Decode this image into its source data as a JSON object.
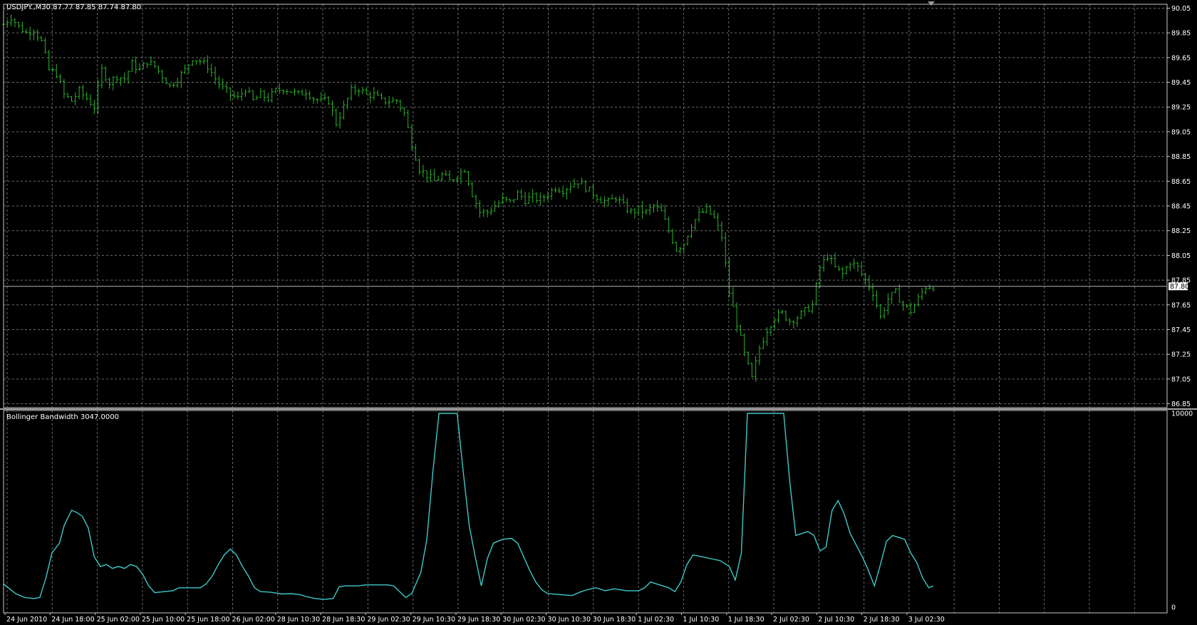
{
  "window": {
    "symbol_header": "USDJPY.,M30  87.77 87.85 87.74 87.80",
    "indicator_header": "Bollinger Bandwidth 3047.0000"
  },
  "colors": {
    "background": "#000000",
    "grid": "#6b6b6b",
    "bars": "#2db32d",
    "indicator": "#3fc8c8",
    "frame": "#c8c8c8",
    "price_line": "#b4b4b4"
  },
  "chart_data": [
    {
      "type": "bar",
      "title": "USDJPY.,M30",
      "ohlc_header": "87.77 87.85 87.74 87.80",
      "y_ticks": [
        "90.05",
        "89.85",
        "89.65",
        "89.45",
        "89.25",
        "89.05",
        "88.85",
        "88.65",
        "88.45",
        "88.25",
        "88.05",
        "87.85",
        "87.65",
        "87.45",
        "87.25",
        "87.05",
        "86.85"
      ],
      "ylim": [
        86.83,
        90.07
      ],
      "current_price": "87.80",
      "x_ticks": [
        "24 Jun 2010",
        "24 Jun 18:00",
        "25 Jun 02:00",
        "25 Jun 10:00",
        "25 Jun 18:00",
        "26 Jun 02:00",
        "28 Jun 10:30",
        "28 Jun 18:30",
        "29 Jun 02:30",
        "29 Jun 10:30",
        "29 Jun 18:30",
        "30 Jun 02:30",
        "30 Jun 10:30",
        "30 Jun 18:30",
        "1 Jul 02:30",
        "1 Jul 10:30",
        "1 Jul 18:30",
        "2 Jul 02:30",
        "2 Jul 10:30",
        "2 Jul 18:30",
        "3 Jul 02:30"
      ],
      "close_path": [
        [
          0,
          89.92
        ],
        [
          5,
          89.98
        ],
        [
          10,
          89.9
        ],
        [
          15,
          89.85
        ],
        [
          20,
          89.88
        ],
        [
          25,
          89.78
        ],
        [
          30,
          89.55
        ],
        [
          35,
          89.52
        ],
        [
          40,
          89.35
        ],
        [
          45,
          89.3
        ],
        [
          50,
          89.38
        ],
        [
          55,
          89.32
        ],
        [
          60,
          89.25
        ],
        [
          65,
          89.55
        ],
        [
          70,
          89.45
        ],
        [
          75,
          89.5
        ],
        [
          80,
          89.48
        ],
        [
          85,
          89.6
        ],
        [
          90,
          89.55
        ],
        [
          95,
          89.62
        ],
        [
          100,
          89.58
        ],
        [
          105,
          89.5
        ],
        [
          110,
          89.42
        ],
        [
          115,
          89.48
        ],
        [
          120,
          89.55
        ],
        [
          125,
          89.65
        ],
        [
          130,
          89.62
        ],
        [
          135,
          89.58
        ],
        [
          140,
          89.48
        ],
        [
          145,
          89.4
        ],
        [
          150,
          89.35
        ],
        [
          155,
          89.32
        ],
        [
          160,
          89.4
        ],
        [
          165,
          89.3
        ],
        [
          170,
          89.35
        ],
        [
          175,
          89.32
        ],
        [
          180,
          89.38
        ],
        [
          185,
          89.4
        ],
        [
          190,
          89.38
        ],
        [
          195,
          89.35
        ],
        [
          200,
          89.38
        ],
        [
          205,
          89.32
        ],
        [
          210,
          89.3
        ],
        [
          215,
          89.3
        ],
        [
          220,
          89.12
        ],
        [
          225,
          89.25
        ],
        [
          230,
          89.38
        ],
        [
          235,
          89.4
        ],
        [
          240,
          89.35
        ],
        [
          245,
          89.35
        ],
        [
          250,
          89.3
        ],
        [
          255,
          89.3
        ],
        [
          260,
          89.3
        ],
        [
          265,
          89.2
        ],
        [
          270,
          88.95
        ],
        [
          275,
          88.75
        ],
        [
          280,
          88.7
        ],
        [
          285,
          88.65
        ],
        [
          290,
          88.7
        ],
        [
          295,
          88.65
        ],
        [
          300,
          88.7
        ],
        [
          305,
          88.75
        ],
        [
          310,
          88.55
        ],
        [
          315,
          88.4
        ],
        [
          320,
          88.4
        ],
        [
          325,
          88.45
        ],
        [
          330,
          88.5
        ],
        [
          335,
          88.48
        ],
        [
          340,
          88.55
        ],
        [
          345,
          88.5
        ],
        [
          350,
          88.52
        ],
        [
          355,
          88.5
        ],
        [
          360,
          88.55
        ],
        [
          365,
          88.6
        ],
        [
          370,
          88.58
        ],
        [
          375,
          88.62
        ],
        [
          380,
          88.65
        ],
        [
          385,
          88.6
        ],
        [
          390,
          88.55
        ],
        [
          395,
          88.5
        ],
        [
          400,
          88.48
        ],
        [
          405,
          88.52
        ],
        [
          410,
          88.45
        ],
        [
          415,
          88.4
        ],
        [
          420,
          88.42
        ],
        [
          425,
          88.4
        ],
        [
          430,
          88.45
        ],
        [
          435,
          88.4
        ],
        [
          440,
          88.25
        ],
        [
          445,
          88.1
        ],
        [
          450,
          88.15
        ],
        [
          455,
          88.3
        ],
        [
          460,
          88.38
        ],
        [
          465,
          88.42
        ],
        [
          470,
          88.35
        ],
        [
          475,
          88.2
        ],
        [
          480,
          87.75
        ],
        [
          485,
          87.5
        ],
        [
          490,
          87.25
        ],
        [
          495,
          87.05
        ],
        [
          500,
          87.3
        ],
        [
          505,
          87.45
        ],
        [
          510,
          87.55
        ],
        [
          515,
          87.58
        ],
        [
          520,
          87.52
        ],
        [
          525,
          87.55
        ],
        [
          530,
          87.6
        ],
        [
          535,
          87.65
        ],
        [
          540,
          87.95
        ],
        [
          545,
          88.05
        ],
        [
          550,
          87.95
        ],
        [
          555,
          87.9
        ],
        [
          560,
          88.0
        ],
        [
          565,
          87.95
        ],
        [
          570,
          87.85
        ],
        [
          575,
          87.75
        ],
        [
          580,
          87.55
        ],
        [
          585,
          87.7
        ],
        [
          590,
          87.75
        ],
        [
          595,
          87.65
        ],
        [
          600,
          87.6
        ],
        [
          605,
          87.7
        ],
        [
          610,
          87.8
        ]
      ]
    },
    {
      "type": "line",
      "title": "Bollinger Bandwidth 3047.0000",
      "y_ticks": [
        "10000",
        "0"
      ],
      "ylim": [
        0,
        10000
      ],
      "series": [
        {
          "values": [
            [
              0,
              1200
            ],
            [
              8,
              700
            ],
            [
              14,
              500
            ],
            [
              20,
              450
            ],
            [
              24,
              500
            ],
            [
              28,
              1500
            ],
            [
              32,
              2800
            ],
            [
              37,
              3300
            ],
            [
              40,
              4200
            ],
            [
              45,
              5000
            ],
            [
              48,
              4900
            ],
            [
              52,
              4700
            ],
            [
              56,
              4100
            ],
            [
              60,
              2600
            ],
            [
              64,
              2100
            ],
            [
              68,
              2200
            ],
            [
              72,
              2000
            ],
            [
              76,
              2100
            ],
            [
              80,
              2000
            ],
            [
              84,
              2200
            ],
            [
              88,
              2100
            ],
            [
              92,
              1700
            ],
            [
              96,
              1100
            ],
            [
              100,
              750
            ],
            [
              106,
              800
            ],
            [
              112,
              850
            ],
            [
              116,
              1000
            ],
            [
              120,
              1000
            ],
            [
              130,
              1000
            ],
            [
              134,
              1200
            ],
            [
              138,
              1600
            ],
            [
              142,
              2200
            ],
            [
              146,
              2700
            ],
            [
              150,
              3000
            ],
            [
              154,
              2700
            ],
            [
              158,
              2100
            ],
            [
              162,
              1600
            ],
            [
              166,
              1000
            ],
            [
              170,
              800
            ],
            [
              176,
              780
            ],
            [
              184,
              680
            ],
            [
              190,
              700
            ],
            [
              196,
              650
            ],
            [
              200,
              550
            ],
            [
              206,
              450
            ],
            [
              212,
              400
            ],
            [
              218,
              450
            ],
            [
              222,
              1050
            ],
            [
              226,
              1100
            ],
            [
              234,
              1100
            ],
            [
              240,
              1150
            ],
            [
              248,
              1150
            ],
            [
              254,
              1150
            ],
            [
              258,
              1100
            ],
            [
              262,
              800
            ],
            [
              266,
              500
            ],
            [
              270,
              700
            ],
            [
              276,
              1800
            ],
            [
              280,
              3500
            ],
            [
              284,
              7000
            ],
            [
              288,
              10000
            ],
            [
              300,
              10000
            ],
            [
              304,
              7000
            ],
            [
              308,
              4200
            ],
            [
              312,
              2600
            ],
            [
              316,
              1100
            ],
            [
              320,
              2500
            ],
            [
              324,
              3300
            ],
            [
              330,
              3500
            ],
            [
              336,
              3550
            ],
            [
              340,
              3300
            ],
            [
              344,
              2600
            ],
            [
              348,
              1900
            ],
            [
              352,
              1300
            ],
            [
              356,
              900
            ],
            [
              360,
              700
            ],
            [
              368,
              650
            ],
            [
              376,
              600
            ],
            [
              382,
              800
            ],
            [
              386,
              900
            ],
            [
              392,
              1000
            ],
            [
              398,
              850
            ],
            [
              404,
              950
            ],
            [
              412,
              850
            ],
            [
              420,
              850
            ],
            [
              424,
              1000
            ],
            [
              428,
              1300
            ],
            [
              432,
              1200
            ],
            [
              436,
              1100
            ],
            [
              440,
              1000
            ],
            [
              444,
              800
            ],
            [
              448,
              1300
            ],
            [
              452,
              2200
            ],
            [
              456,
              2700
            ],
            [
              462,
              2600
            ],
            [
              468,
              2500
            ],
            [
              474,
              2400
            ],
            [
              480,
              2100
            ],
            [
              484,
              1400
            ],
            [
              488,
              2800
            ],
            [
              492,
              10000
            ],
            [
              516,
              10000
            ],
            [
              520,
              6500
            ],
            [
              524,
              3700
            ],
            [
              528,
              3800
            ],
            [
              532,
              3900
            ],
            [
              536,
              3700
            ],
            [
              540,
              2900
            ],
            [
              544,
              3100
            ],
            [
              548,
              5000
            ],
            [
              552,
              5500
            ],
            [
              556,
              4800
            ],
            [
              560,
              3800
            ],
            [
              564,
              3200
            ],
            [
              568,
              2600
            ],
            [
              572,
              1900
            ],
            [
              576,
              1100
            ],
            [
              580,
              2200
            ],
            [
              584,
              3400
            ],
            [
              588,
              3700
            ],
            [
              592,
              3600
            ],
            [
              596,
              3500
            ],
            [
              600,
              2800
            ],
            [
              604,
              2300
            ],
            [
              608,
              1500
            ],
            [
              612,
              1000
            ],
            [
              615,
              1100
            ]
          ]
        }
      ]
    }
  ]
}
